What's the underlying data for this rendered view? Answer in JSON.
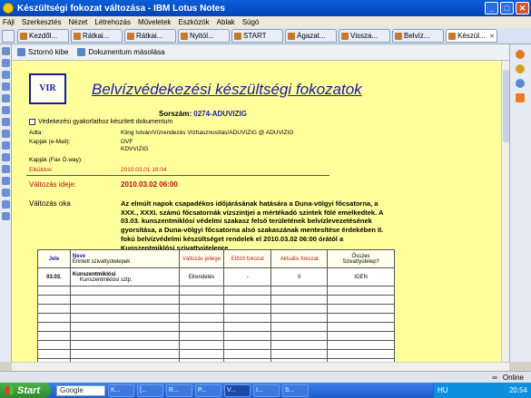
{
  "window": {
    "title": "Készültségi fokozat változása - IBM Lotus Notes",
    "buttons": [
      "_",
      "□",
      "✕"
    ]
  },
  "menu": [
    "Fájl",
    "Szerkesztés",
    "Nézet",
    "Létrehozás",
    "Műveletek",
    "Eszközök",
    "Ablak",
    "Súgó"
  ],
  "tabs": [
    {
      "label": "Kezdől...",
      "active": false
    },
    {
      "label": "Rátkai...",
      "active": false
    },
    {
      "label": "Rátkai...",
      "active": false
    },
    {
      "label": "Nyitól...",
      "active": false
    },
    {
      "label": "START",
      "active": false
    },
    {
      "label": "Ágazat...",
      "active": false
    },
    {
      "label": "Vissza...",
      "active": false
    },
    {
      "label": "Belvíz...",
      "active": false
    },
    {
      "label": "Készül...",
      "active": true
    }
  ],
  "actions": {
    "print": "Sztornó kibe",
    "copy": "Dokumentum másolása"
  },
  "document": {
    "logo": "VIR",
    "title": "Belvízvédekezési készültségi fokozatok",
    "serial_label": "Sorszám:",
    "serial_value": "0274-ADUVIZIG",
    "checkbox_label": "Védekezési gyakorlathoz készített dokumentum",
    "fields": {
      "author_label": "Adta:",
      "author_value": "Kling István/Vízrendezés Vízhasznosítás/ADUVIZIG @ ADUVIZIG",
      "email_label": "Kapják (e-Mail):",
      "email_value1": "OVF",
      "email_value2": "KDVVIZIG",
      "fax_label": "Kapják (Fax Ö.way):",
      "sent_label": "Elküldve:",
      "sent_value": "2010.03.01 16:04"
    },
    "change_time_label": "Változás ideje:",
    "change_time_value": "2010.03.02 06:00",
    "reason_label": "Változás oka",
    "reason_text": "Az elmúlt napok csapadékos időjárásának hatására a Duna-völgyi főcsatorna, a XXX., XXXI. számú főcsatornák vízszintjei a mértékadó szintek fölé emelkedtek. A 03.03. kunszentmiklósi védelmi szakasz felső területének belvízlevezetésének gyorsítása, a Duna-völgyi főcsatorna alsó szakaszának mentesítése érdekében II. fokú belvízvédelmi készültséget rendelek el 2010.03.02 06:00 órától a Kunszentmiklósi szivattyútelepre.",
    "table": {
      "headers": {
        "jele": "Jele",
        "neve": "Neve",
        "neve_sub": "Érintett szivattyútelepek",
        "jelleg": "Változás jellege",
        "elozo": "Előző fokozat",
        "aktualis": "Aktuális fokozat",
        "osszes": "Összes",
        "osszes_sub": "Szivattyútelep?"
      },
      "rows": [
        {
          "jele": "03.03.",
          "neve": "Kunszentmiklósi",
          "neve_sub": "Kunszentmiklósi sztp.",
          "jelleg": "Elrendelés",
          "elozo": "-",
          "aktualis": "II",
          "osszes": "IGEN"
        },
        {
          "jele": "",
          "neve": "",
          "neve_sub": "",
          "jelleg": "",
          "elozo": "",
          "aktualis": "",
          "osszes": ""
        },
        {
          "jele": "",
          "neve": "",
          "neve_sub": "",
          "jelleg": "",
          "elozo": "",
          "aktualis": "",
          "osszes": ""
        },
        {
          "jele": "",
          "neve": "",
          "neve_sub": "",
          "jelleg": "",
          "elozo": "",
          "aktualis": "",
          "osszes": ""
        },
        {
          "jele": "",
          "neve": "",
          "neve_sub": "",
          "jelleg": "",
          "elozo": "",
          "aktualis": "",
          "osszes": ""
        },
        {
          "jele": "",
          "neve": "",
          "neve_sub": "",
          "jelleg": "",
          "elozo": "",
          "aktualis": "",
          "osszes": ""
        },
        {
          "jele": "",
          "neve": "",
          "neve_sub": "",
          "jelleg": "",
          "elozo": "",
          "aktualis": "",
          "osszes": ""
        },
        {
          "jele": "",
          "neve": "",
          "neve_sub": "",
          "jelleg": "",
          "elozo": "",
          "aktualis": "",
          "osszes": ""
        },
        {
          "jele": "",
          "neve": "",
          "neve_sub": "",
          "jelleg": "",
          "elozo": "",
          "aktualis": "",
          "osszes": ""
        },
        {
          "jele": "",
          "neve": "",
          "neve_sub": "",
          "jelleg": "",
          "elozo": "",
          "aktualis": "",
          "osszes": ""
        },
        {
          "jele": "",
          "neve": "",
          "neve_sub": "",
          "jelleg": "",
          "elozo": "",
          "aktualis": "",
          "osszes": ""
        },
        {
          "jele": "",
          "neve": "",
          "neve_sub": "",
          "jelleg": "",
          "elozo": "",
          "aktualis": "",
          "osszes": ""
        }
      ]
    }
  },
  "status": {
    "online": "Online"
  },
  "taskbar": {
    "start": "Start",
    "search": "Google",
    "items": [
      "K...",
      "[...",
      "R...",
      "P...",
      "V...",
      "I...",
      "S..."
    ],
    "lang": "HU",
    "clock": "20:54"
  }
}
